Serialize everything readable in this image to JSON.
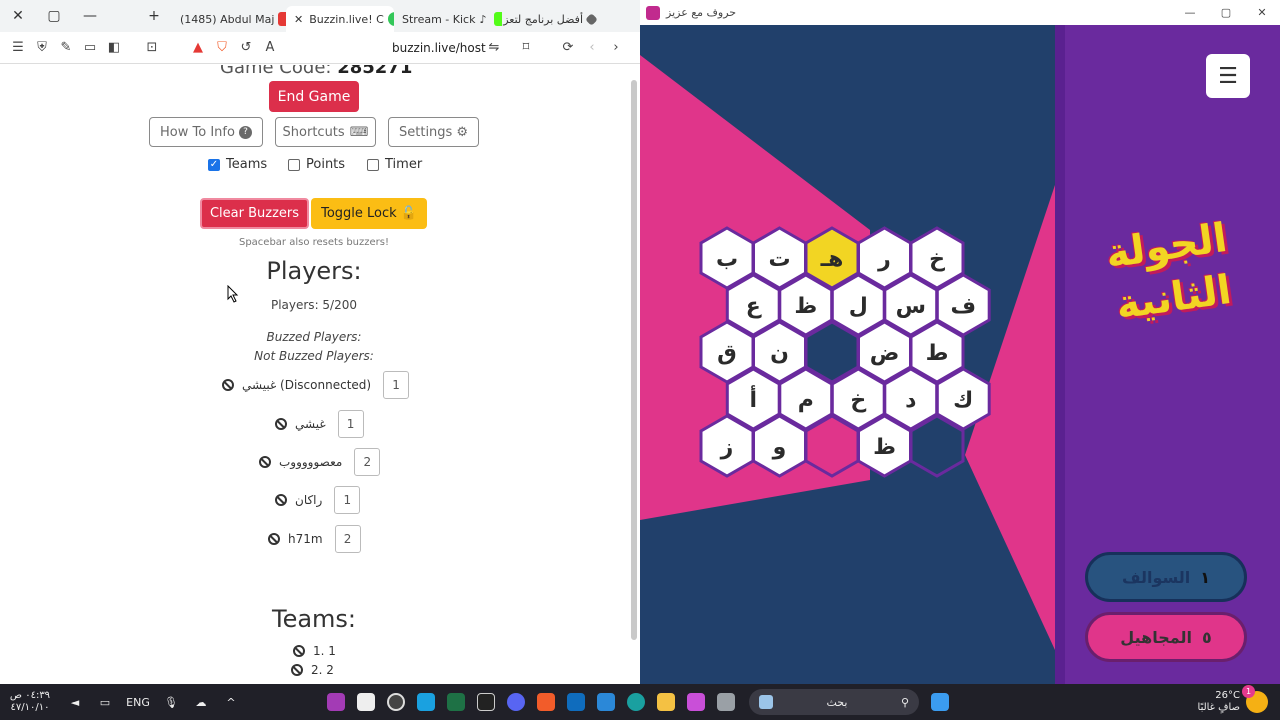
{
  "browser": {
    "tabs": [
      {
        "title": "(1485) Abdul Maj",
        "color": "#e53935"
      },
      {
        "title": "Buzzin.live! C",
        "color": "#34c759"
      },
      {
        "title": "Stream - Kick",
        "color": "#53fc18"
      },
      {
        "title": "أفضل برنامج لتعز",
        "color": "#888888"
      }
    ],
    "url": "buzzin.live/host"
  },
  "host": {
    "game_code_label": "Game Code:",
    "game_code": "285271",
    "end_game": "End Game",
    "how_to": "How To Info",
    "shortcuts": "Shortcuts",
    "settings": "Settings",
    "options": [
      {
        "label": "Teams",
        "checked": true
      },
      {
        "label": "Points",
        "checked": false
      },
      {
        "label": "Timer",
        "checked": false
      }
    ],
    "clear_buzzers": "Clear Buzzers",
    "toggle_lock": "Toggle Lock",
    "hint": "Spacebar also resets buzzers!",
    "players_heading": "Players:",
    "players_count": "Players: 5/200",
    "buzzed": "Buzzed Players:",
    "not_buzzed": "Not Buzzed Players:",
    "players": [
      {
        "name": "غبيشي (Disconnected)",
        "team": "1"
      },
      {
        "name": "غيشي",
        "team": "1"
      },
      {
        "name": "معصوووووب",
        "team": "2"
      },
      {
        "name": "راكان",
        "team": "1"
      },
      {
        "name": "h71m",
        "team": "2"
      }
    ],
    "teams_heading": "Teams:",
    "teams": [
      "1.  1",
      "2.  2"
    ]
  },
  "game": {
    "window_title": "حروف مع عزيز",
    "round_title": "الجولة الثانية",
    "colors": {
      "pink": "#e0358a",
      "navy": "#21406b",
      "purple": "#6a2a9e",
      "yellow": "#f2d523"
    },
    "hex_rows": [
      [
        {
          "l": "ب",
          "s": "w"
        },
        {
          "l": "ت",
          "s": "w"
        },
        {
          "l": "هـ",
          "s": "y"
        },
        {
          "l": "ر",
          "s": "w"
        },
        {
          "l": "خ",
          "s": "w"
        }
      ],
      [
        {
          "l": "ع",
          "s": "w"
        },
        {
          "l": "ظ",
          "s": "w"
        },
        {
          "l": "ل",
          "s": "w"
        },
        {
          "l": "س",
          "s": "w"
        },
        {
          "l": "ف",
          "s": "w"
        }
      ],
      [
        {
          "l": "ق",
          "s": "w"
        },
        {
          "l": "ن",
          "s": "w"
        },
        {
          "l": "",
          "s": "n"
        },
        {
          "l": "ض",
          "s": "w"
        },
        {
          "l": "ط",
          "s": "w"
        }
      ],
      [
        {
          "l": "أ",
          "s": "w"
        },
        {
          "l": "م",
          "s": "w"
        },
        {
          "l": "خ",
          "s": "w"
        },
        {
          "l": "د",
          "s": "w"
        },
        {
          "l": "ك",
          "s": "w"
        }
      ],
      [
        {
          "l": "ز",
          "s": "w"
        },
        {
          "l": "و",
          "s": "w"
        },
        {
          "l": "",
          "s": "p"
        },
        {
          "l": "ظ",
          "s": "w"
        },
        {
          "l": "",
          "s": "n"
        }
      ]
    ],
    "score_top": {
      "value": "١",
      "label": "السوالف"
    },
    "score_bottom": {
      "value": "٥",
      "label": "المجاهيل"
    }
  },
  "taskbar": {
    "time": "٠٤:٣٩ ص",
    "date": "٤٧/١٠/١٠",
    "lang": "ENG",
    "search": "بحث",
    "temp": "26°C",
    "weather": "صافٍ غالبًا",
    "notif": "1"
  }
}
